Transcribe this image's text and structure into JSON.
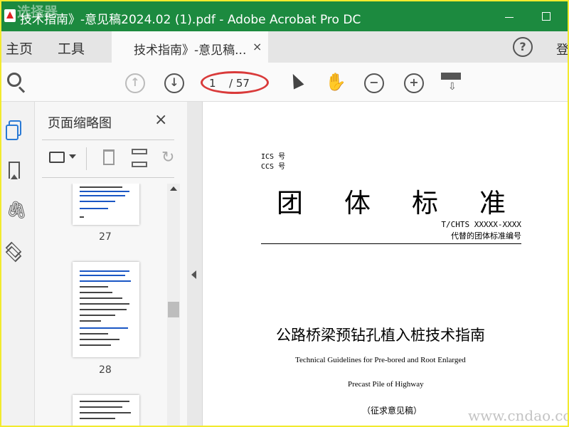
{
  "window": {
    "title": "技术指南》-意见稿2024.02 (1).pdf - Adobe Acrobat Pro DC",
    "watermark_top": "选择器",
    "watermark_bottom": "www.cndao.com"
  },
  "menu": {
    "home": "主页",
    "tools": "工具",
    "login": "登"
  },
  "tab": {
    "label": "技术指南》-意见稿...",
    "close": "×"
  },
  "toolbar": {
    "help": "?",
    "page_current": "1",
    "page_total": "/ 57",
    "prev_glyph": "↑",
    "next_glyph": "↓",
    "zoom_out_glyph": "−",
    "zoom_in_glyph": "+",
    "hand_glyph": "✋",
    "marquee_glyph": "⇩",
    "colors": {
      "accent": "#2a7ad5",
      "highlight": "#d93a3a",
      "titlebar": "#1c8a3f"
    }
  },
  "rail": {
    "attachment_glyph": "🖇",
    "icons": [
      "pages-panel-icon",
      "bookmark-icon",
      "attachment-icon",
      "layers-icon"
    ]
  },
  "panel": {
    "title": "页面缩略图",
    "close": "×",
    "rotate_glyph": "↻",
    "thumbnails": [
      {
        "page": "27"
      },
      {
        "page": "28"
      }
    ]
  },
  "document": {
    "ics": "ICS 号",
    "ccs": "CCS 号",
    "std_type": "团体标准",
    "std_number": "T/CHTS XXXXX-XXXX",
    "replaces": "代替的团体标准编号",
    "title_cn": "公路桥梁预钻孔植入桩技术指南",
    "title_en_line1": "Technical Guidelines for Pre-bored and Root Enlarged",
    "title_en_line2": "Precast Pile of Highway",
    "draft": "（征求意见稿）"
  }
}
